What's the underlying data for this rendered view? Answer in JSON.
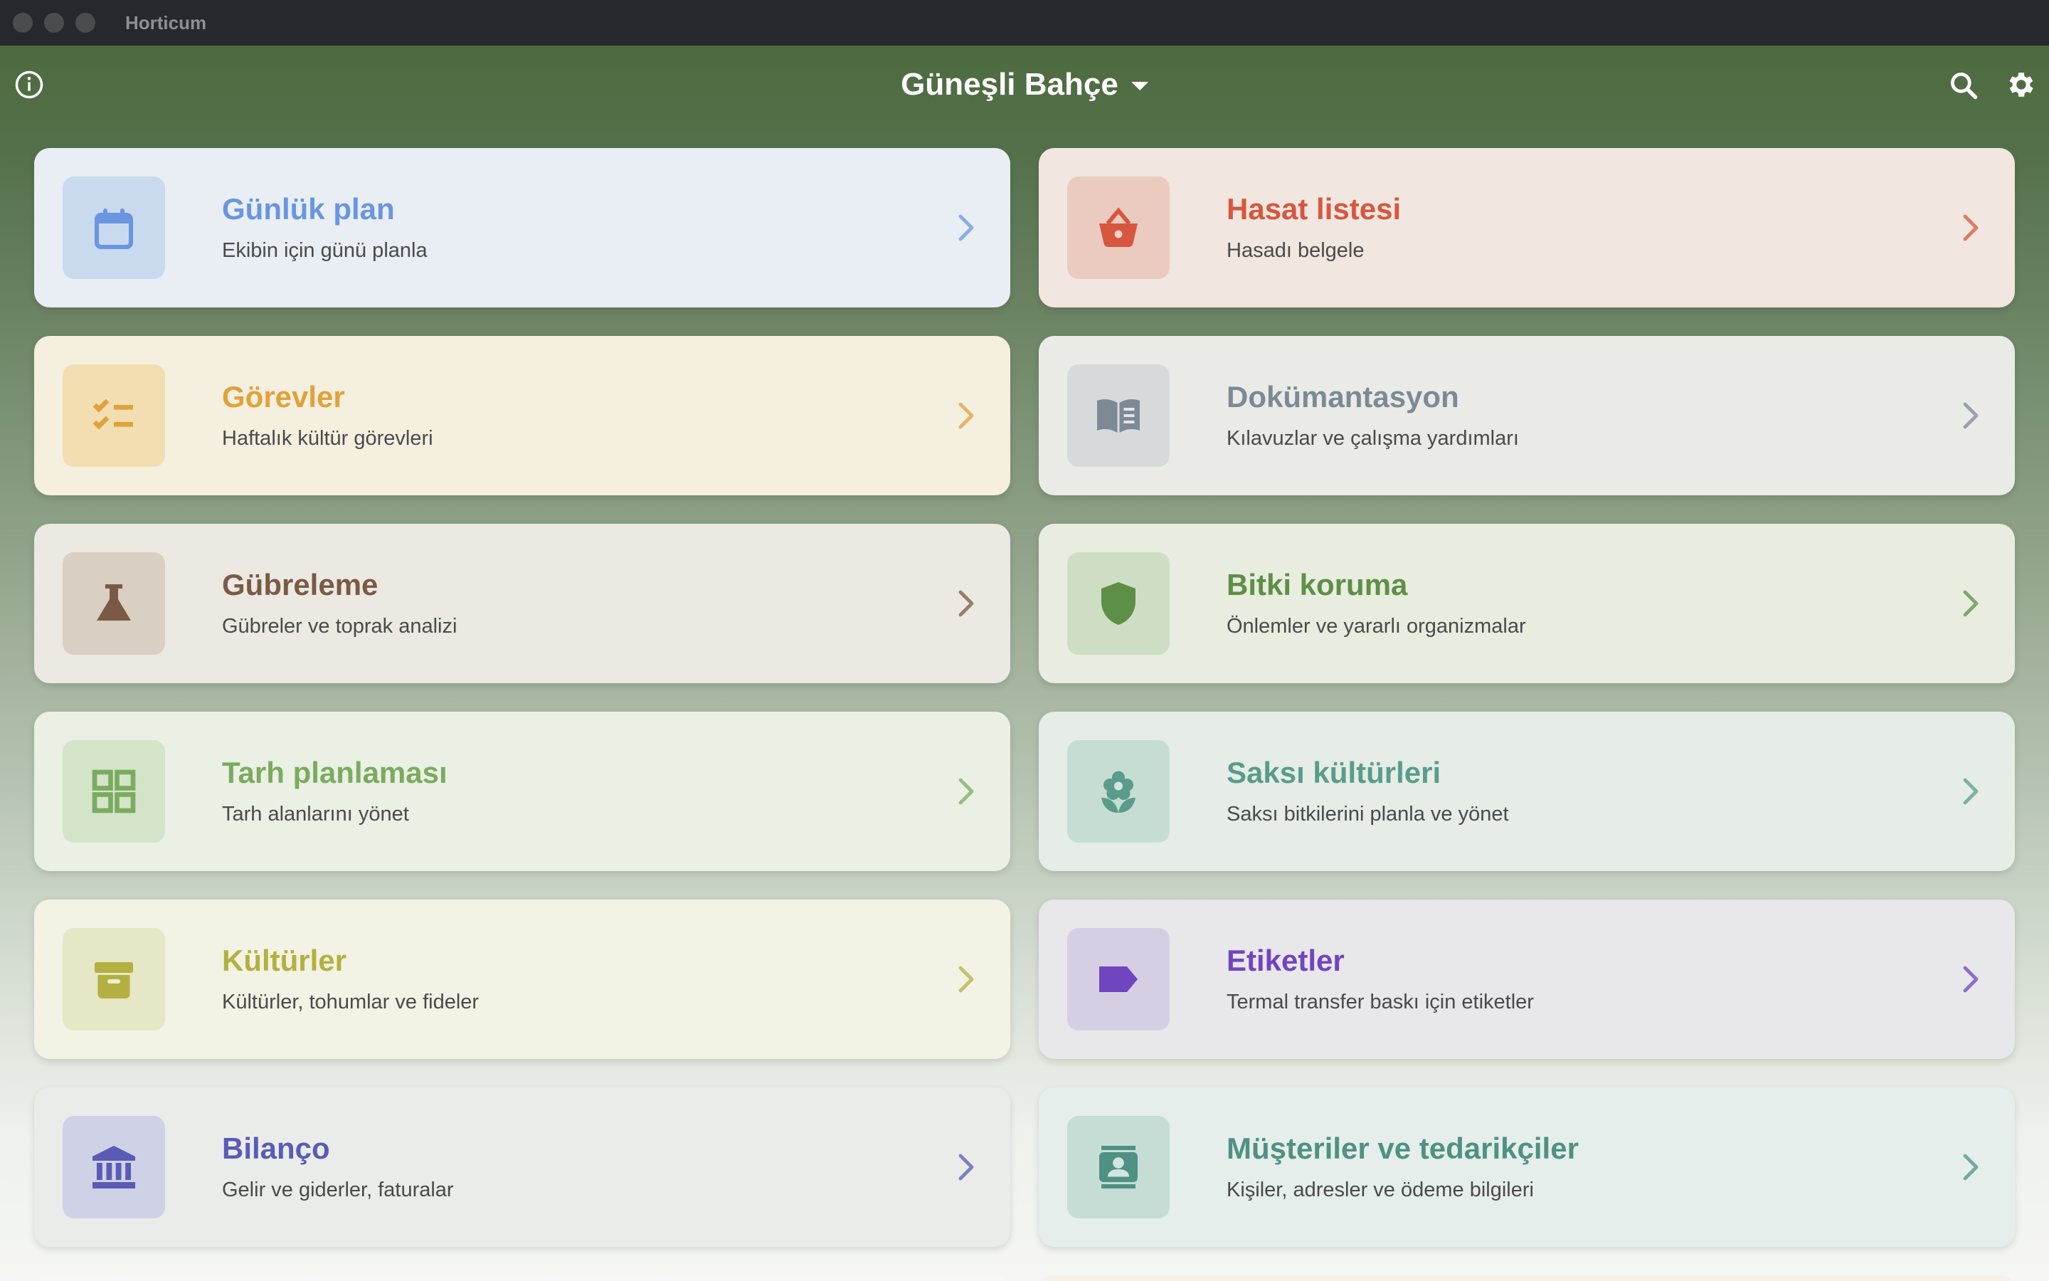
{
  "window": {
    "title": "Horticum"
  },
  "header": {
    "garden_name": "Güneşli Bahçe"
  },
  "cards": [
    {
      "title": "Günlük plan",
      "subtitle": "Ekibin için günü planla",
      "icon": "calendar-icon",
      "accent": "#6a95e0",
      "bg": "#e8eef3",
      "icon_bg": "#c9d9ee"
    },
    {
      "title": "Hasat listesi",
      "subtitle": "Hasadı belgele",
      "icon": "basket-icon",
      "accent": "#d6573d",
      "bg": "#f1e6e0",
      "icon_bg": "#ebcbc0"
    },
    {
      "title": "Görevler",
      "subtitle": "Haftalık kültür görevleri",
      "icon": "checklist-icon",
      "accent": "#e0a23a",
      "bg": "#f4efdf",
      "icon_bg": "#f2deb1"
    },
    {
      "title": "Dokümantasyon",
      "subtitle": "Kılavuzlar ve çalışma yardımları",
      "icon": "book-icon",
      "accent": "#7d8a96",
      "bg": "#eaebe7",
      "icon_bg": "#d7dadb"
    },
    {
      "title": "Gübreleme",
      "subtitle": "Gübreler ve toprak analizi",
      "icon": "flask-icon",
      "accent": "#7a5a45",
      "bg": "#ebe9e2",
      "icon_bg": "#d9cfc2"
    },
    {
      "title": "Bitki koruma",
      "subtitle": "Önlemler ve yararlı organizmalar",
      "icon": "shield-icon",
      "accent": "#5e8f46",
      "bg": "#e8ede0",
      "icon_bg": "#cddec4"
    },
    {
      "title": "Tarh planlaması",
      "subtitle": "Tarh alanlarını yönet",
      "icon": "grid-icon",
      "accent": "#7aab5f",
      "bg": "#eaf0e4",
      "icon_bg": "#d3e4c8"
    },
    {
      "title": "Saksı kültürleri",
      "subtitle": "Saksı bitkilerini planla ve yönet",
      "icon": "flower-icon",
      "accent": "#5a9c8b",
      "bg": "#e5ede6",
      "icon_bg": "#c6ddd4"
    },
    {
      "title": "Kültürler",
      "subtitle": "Kültürler, tohumlar ve fideler",
      "icon": "archive-icon",
      "accent": "#b3b041",
      "bg": "#f2f3e4",
      "icon_bg": "#e6e7c5"
    },
    {
      "title": "Etiketler",
      "subtitle": "Termal transfer baskı için etiketler",
      "icon": "label-icon",
      "accent": "#7145c0",
      "bg": "#e8e7ea",
      "icon_bg": "#d6cfe4"
    },
    {
      "title": "Bilanço",
      "subtitle": "Gelir ve giderler, faturalar",
      "icon": "bank-icon",
      "accent": "#5a5bb5",
      "bg": "#eaecea",
      "icon_bg": "#cfd1e6"
    },
    {
      "title": "Müşteriler ve tedarikçiler",
      "subtitle": "Kişiler, adresler ve ödeme bilgileri",
      "icon": "contact-icon",
      "accent": "#4f9183",
      "bg": "#e5eeea",
      "icon_bg": "#c6ddd6"
    }
  ]
}
